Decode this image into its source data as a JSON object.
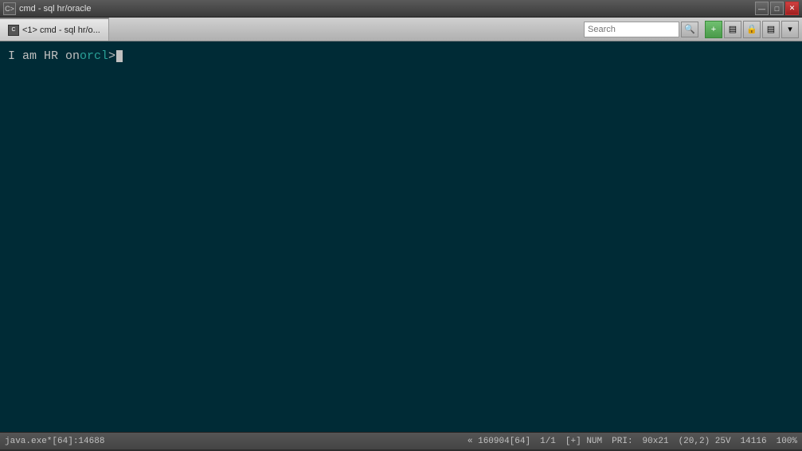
{
  "titlebar": {
    "icon_label": "C>",
    "title": "cmd - sql  hr/oracle",
    "btn_minimize": "—",
    "btn_maximize": "□",
    "btn_close": "✕"
  },
  "toolbar": {
    "tab_label": "<1>  cmd - sql  hr/o...",
    "search_placeholder": "Search",
    "btn_plus": "+",
    "btn_layout": "▤",
    "btn_lock": "🔒",
    "btn_menu": "▤",
    "btn_more": "▾"
  },
  "terminal": {
    "prompt_prefix": "I am HR on ",
    "prompt_instance": "orcl",
    "prompt_suffix": "  > "
  },
  "statusbar": {
    "process": "java.exe*[64]:14688",
    "position": "« 160904[64]",
    "page": "1/1",
    "insert": "[+] NUM",
    "pri": "PRI:",
    "size": "90x21",
    "coords": "(20,2) 25V",
    "filesize": "14116",
    "zoom": "100%"
  }
}
